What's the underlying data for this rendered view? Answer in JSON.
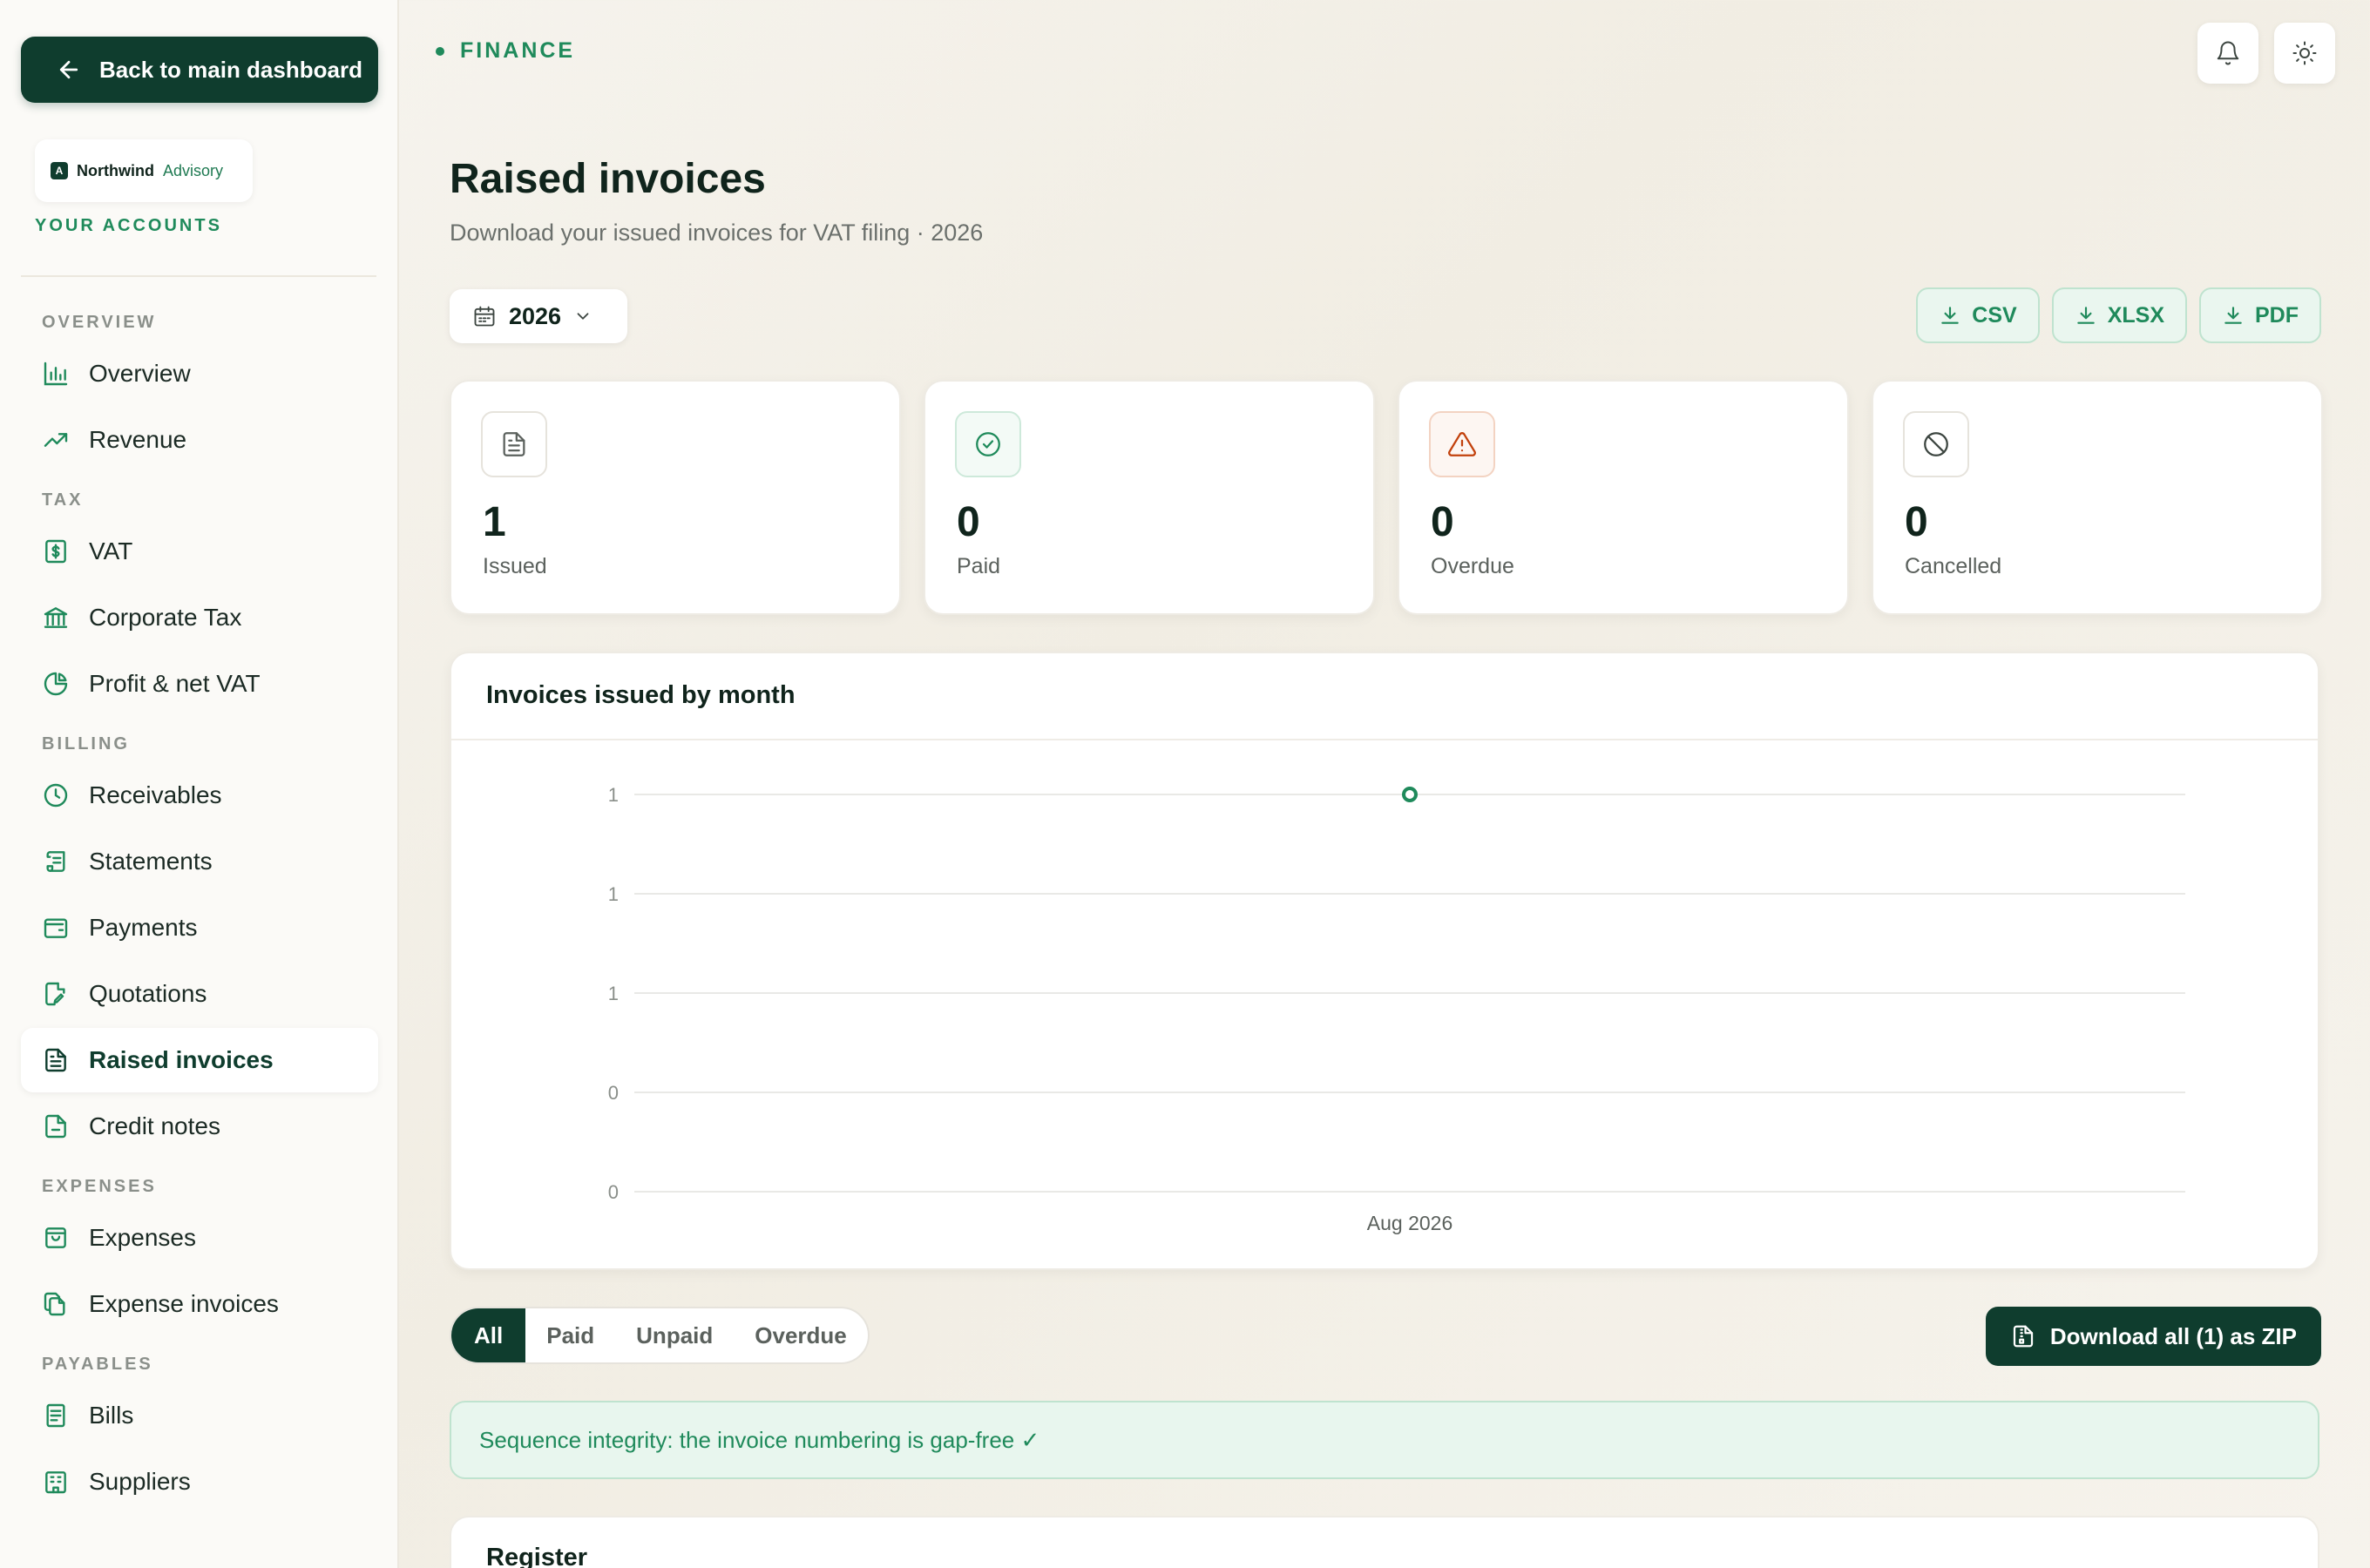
{
  "sidebar": {
    "back_label": "Back to main dashboard",
    "org_name": "Northwind",
    "org_sub": "Advisory",
    "org_logo": "A",
    "accounts_label": "YOUR ACCOUNTS",
    "sections": {
      "overview": "OVERVIEW",
      "tax": "TAX",
      "billing": "BILLING",
      "expenses": "EXPENSES",
      "payables": "PAYABLES"
    },
    "items": {
      "overview": "Overview",
      "revenue": "Revenue",
      "vat": "VAT",
      "corporate_tax": "Corporate Tax",
      "profit_vat": "Profit & net VAT",
      "receivables": "Receivables",
      "statements": "Statements",
      "payments": "Payments",
      "quotations": "Quotations",
      "raised_invoices": "Raised invoices",
      "credit_notes": "Credit notes",
      "expenses": "Expenses",
      "expense_invoices": "Expense invoices",
      "bills": "Bills",
      "suppliers": "Suppliers"
    },
    "active": "raised_invoices"
  },
  "header": {
    "section": "FINANCE",
    "title": "Raised invoices",
    "subtitle": "Download your issued invoices for VAT filing · 2026",
    "icons": [
      "bell-icon",
      "sun-icon"
    ]
  },
  "toolbar": {
    "year": "2026",
    "exports": {
      "csv": "CSV",
      "xlsx": "XLSX",
      "pdf": "PDF"
    }
  },
  "stats": {
    "issued": {
      "value": "1",
      "label": "Issued"
    },
    "paid": {
      "value": "0",
      "label": "Paid"
    },
    "overdue": {
      "value": "0",
      "label": "Overdue"
    },
    "cancelled": {
      "value": "0",
      "label": "Cancelled"
    }
  },
  "chart_card": {
    "title": "Invoices issued by month"
  },
  "chart_data": {
    "type": "line",
    "title": "Invoices issued by month",
    "x": [
      "Aug 2026"
    ],
    "series": [
      {
        "values": [
          1
        ]
      }
    ],
    "yticks": [
      "1",
      "1",
      "1",
      "0",
      "0"
    ],
    "ylim": [
      0,
      1
    ],
    "grid": true,
    "color": "#1f8a5b"
  },
  "filters": {
    "tabs": [
      "All",
      "Paid",
      "Unpaid",
      "Overdue"
    ],
    "active": 0,
    "zip_label": "Download all (1) as ZIP"
  },
  "integrity_text": "Sequence integrity: the invoice numbering is gap-free ✓",
  "register_title": "Register",
  "colors": {
    "brand": "#0f3d2e",
    "accent": "#1f8a5b",
    "warning": "#c2410c"
  }
}
